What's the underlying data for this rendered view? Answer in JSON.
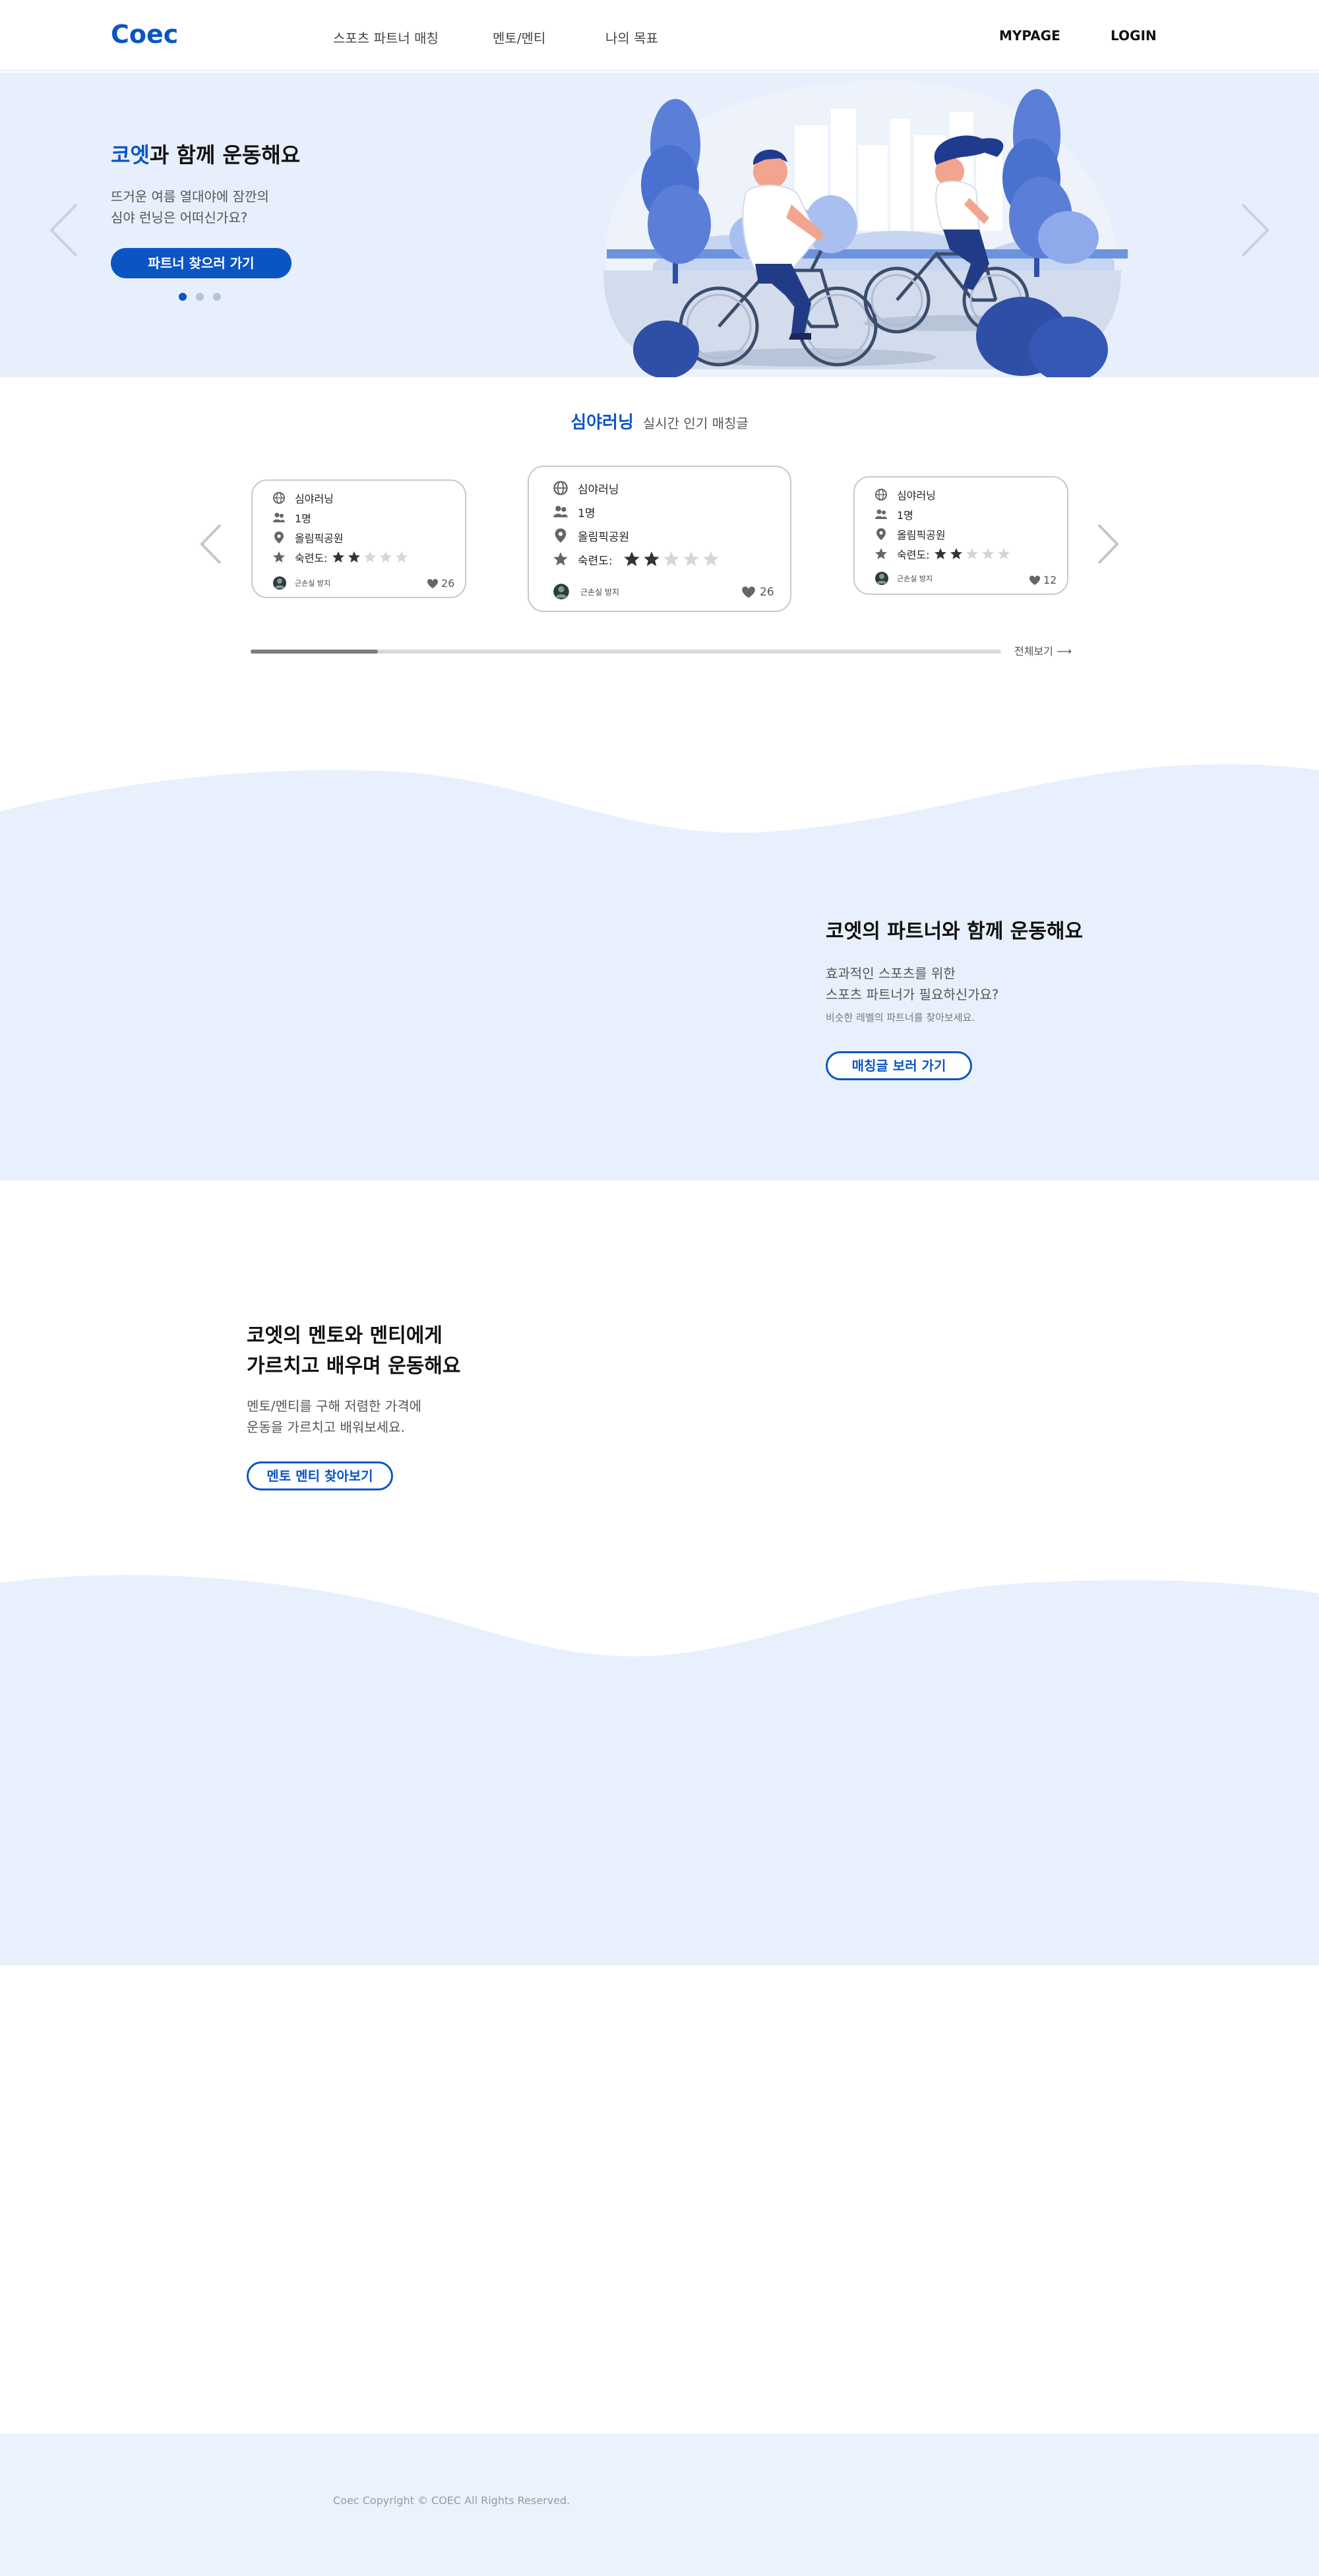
{
  "header": {
    "logo": "Coec",
    "nav": [
      "스포츠 파트너 매칭",
      "멘토/멘티",
      "나의 목표"
    ],
    "mypage": "MYPAGE",
    "login": "LOGIN"
  },
  "hero": {
    "title_accent": "코엣",
    "title_rest": "과 함께 운동해요",
    "sub_line1": "뜨거운 여름 열대야에 잠깐의",
    "sub_line2": "심야 런닝은 어떠신가요?",
    "button": "파트너 찾으러 가기",
    "slides": 3,
    "active_slide": 1
  },
  "popular": {
    "title": "심야러닝",
    "subtitle": "실시간 인기 매칭글",
    "cards": [
      {
        "sport": "심야러닝",
        "people": "1명",
        "place": "올림픽공원",
        "skill_label": "숙련도:",
        "skill": 2,
        "skill_max": 5,
        "user": "근손실 방지",
        "likes": "26"
      },
      {
        "sport": "심야러닝",
        "people": "1명",
        "place": "올림픽공원",
        "skill_label": "숙련도:",
        "skill": 2,
        "skill_max": 5,
        "user": "근손실 방지",
        "likes": "26"
      },
      {
        "sport": "심야러닝",
        "people": "1명",
        "place": "올림픽공원",
        "skill_label": "숙련도:",
        "skill": 2,
        "skill_max": 5,
        "user": "근손실 방지",
        "likes": "12"
      }
    ],
    "scroll_progress": 0.17,
    "view_all": "전체보기"
  },
  "partner_section": {
    "title": "코엣의 파트너와 함께 운동해요",
    "sub_line1": "효과적인 스포츠를 위한",
    "sub_line2": "스포츠 파트너가 필요하신가요?",
    "small": "비슷한 레벨의 파트너를 찾아보세요.",
    "button": "매칭글 보러 가기"
  },
  "mentor_section": {
    "title_line1": "코엣의 멘토와 멘티에게",
    "title_line2": "가르치고 배우며 운동해요",
    "sub_line1": "멘토/멘티를 구해 저렴한 가격에",
    "sub_line2": "운동을 가르치고 배워보세요.",
    "button": "멘토 멘티 찾아보기"
  },
  "footer": {
    "copyright": "Coec Copyright © COEC All Rights Reserved."
  },
  "colors": {
    "brand": "#0b55c3",
    "light_bg": "#e7effc",
    "star_on": "#333333",
    "star_off": "#d6d6d6"
  }
}
